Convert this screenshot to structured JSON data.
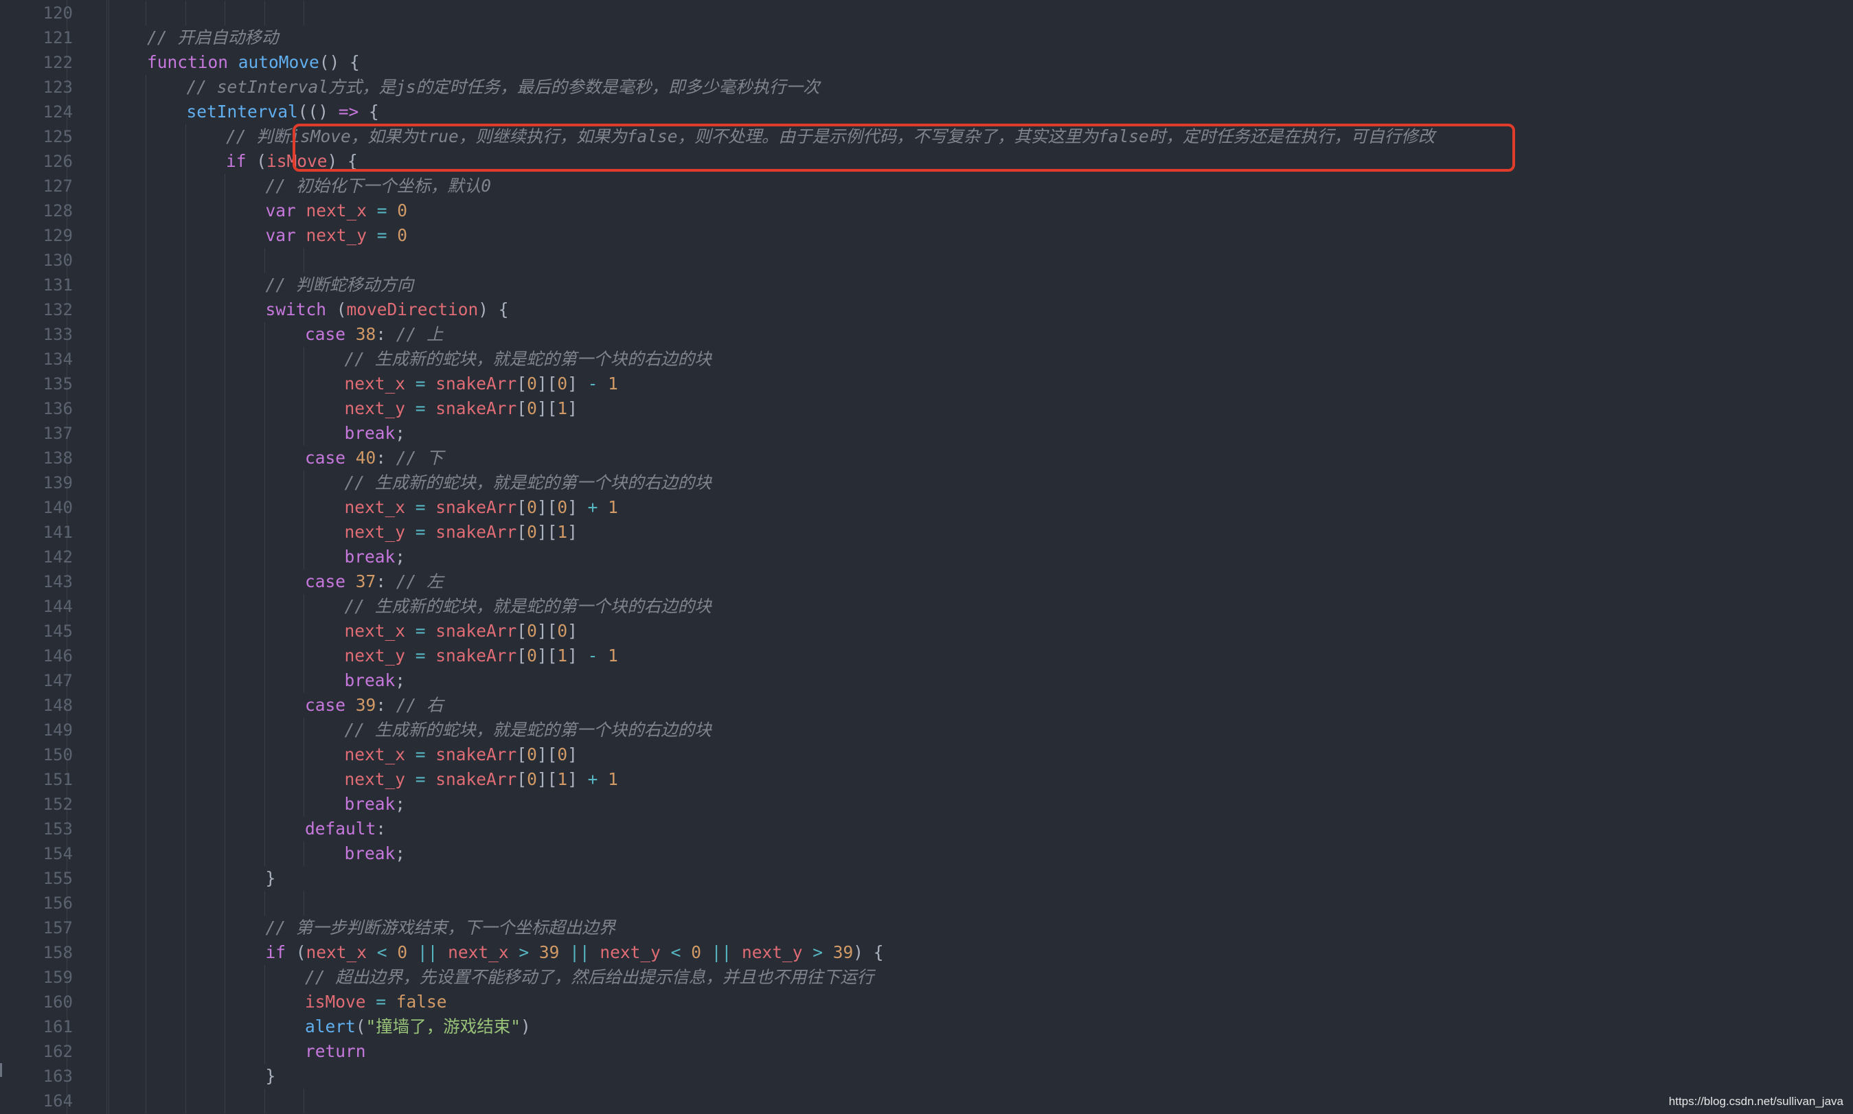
{
  "editor": {
    "lines": [
      {
        "n": "120",
        "indent": 0,
        "tokens": []
      },
      {
        "n": "121",
        "indent": 3,
        "tokens": [
          {
            "c": "cm",
            "t": "// 开启自动移动"
          }
        ]
      },
      {
        "n": "122",
        "indent": 3,
        "tokens": [
          {
            "c": "kw",
            "t": "function "
          },
          {
            "c": "fn",
            "t": "autoMove"
          },
          {
            "c": "pu",
            "t": "() {"
          }
        ]
      },
      {
        "n": "123",
        "indent": 4,
        "tokens": [
          {
            "c": "cm",
            "t": "// setInterval方式，是js的定时任务，最后的参数是毫秒，即多少毫秒执行一次"
          }
        ]
      },
      {
        "n": "124",
        "indent": 4,
        "tokens": [
          {
            "c": "fn",
            "t": "setInterval"
          },
          {
            "c": "pu",
            "t": "(() "
          },
          {
            "c": "kw",
            "t": "=>"
          },
          {
            "c": "pu",
            "t": " {"
          }
        ]
      },
      {
        "n": "125",
        "indent": 5,
        "tokens": [
          {
            "c": "cm",
            "t": "// 判断isMove，如果为true，则继续执行，如果为false，则不处理。由于是示例代码，不写复杂了，其实这里为false时，定时任务还是在执行，可自行修改"
          }
        ]
      },
      {
        "n": "126",
        "indent": 5,
        "tokens": [
          {
            "c": "kw",
            "t": "if"
          },
          {
            "c": "pu",
            "t": " ("
          },
          {
            "c": "var",
            "t": "isMove"
          },
          {
            "c": "pu",
            "t": ") {"
          }
        ]
      },
      {
        "n": "127",
        "indent": 6,
        "tokens": [
          {
            "c": "cm",
            "t": "// 初始化下一个坐标，默认0"
          }
        ]
      },
      {
        "n": "128",
        "indent": 6,
        "tokens": [
          {
            "c": "kw",
            "t": "var "
          },
          {
            "c": "var",
            "t": "next_x"
          },
          {
            "c": "op",
            "t": " = "
          },
          {
            "c": "num",
            "t": "0"
          }
        ]
      },
      {
        "n": "129",
        "indent": 6,
        "tokens": [
          {
            "c": "kw",
            "t": "var "
          },
          {
            "c": "var",
            "t": "next_y"
          },
          {
            "c": "op",
            "t": " = "
          },
          {
            "c": "num",
            "t": "0"
          }
        ]
      },
      {
        "n": "130",
        "indent": 0,
        "tokens": []
      },
      {
        "n": "131",
        "indent": 6,
        "tokens": [
          {
            "c": "cm",
            "t": "// 判断蛇移动方向"
          }
        ]
      },
      {
        "n": "132",
        "indent": 6,
        "tokens": [
          {
            "c": "kw",
            "t": "switch"
          },
          {
            "c": "pu",
            "t": " ("
          },
          {
            "c": "var",
            "t": "moveDirection"
          },
          {
            "c": "pu",
            "t": ") {"
          }
        ]
      },
      {
        "n": "133",
        "indent": 7,
        "tokens": [
          {
            "c": "kw",
            "t": "case "
          },
          {
            "c": "num",
            "t": "38"
          },
          {
            "c": "pu",
            "t": ": "
          },
          {
            "c": "cm",
            "t": "// 上"
          }
        ]
      },
      {
        "n": "134",
        "indent": 8,
        "tokens": [
          {
            "c": "cm",
            "t": "// 生成新的蛇块，就是蛇的第一个块的右边的块"
          }
        ]
      },
      {
        "n": "135",
        "indent": 8,
        "tokens": [
          {
            "c": "var",
            "t": "next_x"
          },
          {
            "c": "op",
            "t": " = "
          },
          {
            "c": "var",
            "t": "snakeArr"
          },
          {
            "c": "pu",
            "t": "["
          },
          {
            "c": "num",
            "t": "0"
          },
          {
            "c": "pu",
            "t": "]["
          },
          {
            "c": "num",
            "t": "0"
          },
          {
            "c": "pu",
            "t": "]"
          },
          {
            "c": "op",
            "t": " - "
          },
          {
            "c": "num",
            "t": "1"
          }
        ]
      },
      {
        "n": "136",
        "indent": 8,
        "tokens": [
          {
            "c": "var",
            "t": "next_y"
          },
          {
            "c": "op",
            "t": " = "
          },
          {
            "c": "var",
            "t": "snakeArr"
          },
          {
            "c": "pu",
            "t": "["
          },
          {
            "c": "num",
            "t": "0"
          },
          {
            "c": "pu",
            "t": "]["
          },
          {
            "c": "num",
            "t": "1"
          },
          {
            "c": "pu",
            "t": "]"
          }
        ]
      },
      {
        "n": "137",
        "indent": 8,
        "tokens": [
          {
            "c": "kw",
            "t": "break"
          },
          {
            "c": "pu",
            "t": ";"
          }
        ]
      },
      {
        "n": "138",
        "indent": 7,
        "tokens": [
          {
            "c": "kw",
            "t": "case "
          },
          {
            "c": "num",
            "t": "40"
          },
          {
            "c": "pu",
            "t": ": "
          },
          {
            "c": "cm",
            "t": "// 下"
          }
        ]
      },
      {
        "n": "139",
        "indent": 8,
        "tokens": [
          {
            "c": "cm",
            "t": "// 生成新的蛇块，就是蛇的第一个块的右边的块"
          }
        ]
      },
      {
        "n": "140",
        "indent": 8,
        "tokens": [
          {
            "c": "var",
            "t": "next_x"
          },
          {
            "c": "op",
            "t": " = "
          },
          {
            "c": "var",
            "t": "snakeArr"
          },
          {
            "c": "pu",
            "t": "["
          },
          {
            "c": "num",
            "t": "0"
          },
          {
            "c": "pu",
            "t": "]["
          },
          {
            "c": "num",
            "t": "0"
          },
          {
            "c": "pu",
            "t": "]"
          },
          {
            "c": "op",
            "t": " + "
          },
          {
            "c": "num",
            "t": "1"
          }
        ]
      },
      {
        "n": "141",
        "indent": 8,
        "tokens": [
          {
            "c": "var",
            "t": "next_y"
          },
          {
            "c": "op",
            "t": " = "
          },
          {
            "c": "var",
            "t": "snakeArr"
          },
          {
            "c": "pu",
            "t": "["
          },
          {
            "c": "num",
            "t": "0"
          },
          {
            "c": "pu",
            "t": "]["
          },
          {
            "c": "num",
            "t": "1"
          },
          {
            "c": "pu",
            "t": "]"
          }
        ]
      },
      {
        "n": "142",
        "indent": 8,
        "tokens": [
          {
            "c": "kw",
            "t": "break"
          },
          {
            "c": "pu",
            "t": ";"
          }
        ]
      },
      {
        "n": "143",
        "indent": 7,
        "tokens": [
          {
            "c": "kw",
            "t": "case "
          },
          {
            "c": "num",
            "t": "37"
          },
          {
            "c": "pu",
            "t": ": "
          },
          {
            "c": "cm",
            "t": "// 左"
          }
        ]
      },
      {
        "n": "144",
        "indent": 8,
        "tokens": [
          {
            "c": "cm",
            "t": "// 生成新的蛇块，就是蛇的第一个块的右边的块"
          }
        ]
      },
      {
        "n": "145",
        "indent": 8,
        "tokens": [
          {
            "c": "var",
            "t": "next_x"
          },
          {
            "c": "op",
            "t": " = "
          },
          {
            "c": "var",
            "t": "snakeArr"
          },
          {
            "c": "pu",
            "t": "["
          },
          {
            "c": "num",
            "t": "0"
          },
          {
            "c": "pu",
            "t": "]["
          },
          {
            "c": "num",
            "t": "0"
          },
          {
            "c": "pu",
            "t": "]"
          }
        ]
      },
      {
        "n": "146",
        "indent": 8,
        "tokens": [
          {
            "c": "var",
            "t": "next_y"
          },
          {
            "c": "op",
            "t": " = "
          },
          {
            "c": "var",
            "t": "snakeArr"
          },
          {
            "c": "pu",
            "t": "["
          },
          {
            "c": "num",
            "t": "0"
          },
          {
            "c": "pu",
            "t": "]["
          },
          {
            "c": "num",
            "t": "1"
          },
          {
            "c": "pu",
            "t": "]"
          },
          {
            "c": "op",
            "t": " - "
          },
          {
            "c": "num",
            "t": "1"
          }
        ]
      },
      {
        "n": "147",
        "indent": 8,
        "tokens": [
          {
            "c": "kw",
            "t": "break"
          },
          {
            "c": "pu",
            "t": ";"
          }
        ]
      },
      {
        "n": "148",
        "indent": 7,
        "tokens": [
          {
            "c": "kw",
            "t": "case "
          },
          {
            "c": "num",
            "t": "39"
          },
          {
            "c": "pu",
            "t": ": "
          },
          {
            "c": "cm",
            "t": "// 右"
          }
        ]
      },
      {
        "n": "149",
        "indent": 8,
        "tokens": [
          {
            "c": "cm",
            "t": "// 生成新的蛇块，就是蛇的第一个块的右边的块"
          }
        ]
      },
      {
        "n": "150",
        "indent": 8,
        "tokens": [
          {
            "c": "var",
            "t": "next_x"
          },
          {
            "c": "op",
            "t": " = "
          },
          {
            "c": "var",
            "t": "snakeArr"
          },
          {
            "c": "pu",
            "t": "["
          },
          {
            "c": "num",
            "t": "0"
          },
          {
            "c": "pu",
            "t": "]["
          },
          {
            "c": "num",
            "t": "0"
          },
          {
            "c": "pu",
            "t": "]"
          }
        ]
      },
      {
        "n": "151",
        "indent": 8,
        "tokens": [
          {
            "c": "var",
            "t": "next_y"
          },
          {
            "c": "op",
            "t": " = "
          },
          {
            "c": "var",
            "t": "snakeArr"
          },
          {
            "c": "pu",
            "t": "["
          },
          {
            "c": "num",
            "t": "0"
          },
          {
            "c": "pu",
            "t": "]["
          },
          {
            "c": "num",
            "t": "1"
          },
          {
            "c": "pu",
            "t": "]"
          },
          {
            "c": "op",
            "t": " + "
          },
          {
            "c": "num",
            "t": "1"
          }
        ]
      },
      {
        "n": "152",
        "indent": 8,
        "tokens": [
          {
            "c": "kw",
            "t": "break"
          },
          {
            "c": "pu",
            "t": ";"
          }
        ]
      },
      {
        "n": "153",
        "indent": 7,
        "tokens": [
          {
            "c": "kw",
            "t": "default"
          },
          {
            "c": "pu",
            "t": ":"
          }
        ]
      },
      {
        "n": "154",
        "indent": 8,
        "tokens": [
          {
            "c": "kw",
            "t": "break"
          },
          {
            "c": "pu",
            "t": ";"
          }
        ]
      },
      {
        "n": "155",
        "indent": 6,
        "tokens": [
          {
            "c": "pu",
            "t": "}"
          }
        ]
      },
      {
        "n": "156",
        "indent": 0,
        "tokens": []
      },
      {
        "n": "157",
        "indent": 6,
        "tokens": [
          {
            "c": "cm",
            "t": "// 第一步判断游戏结束，下一个坐标超出边界"
          }
        ]
      },
      {
        "n": "158",
        "indent": 6,
        "tokens": [
          {
            "c": "kw",
            "t": "if"
          },
          {
            "c": "pu",
            "t": " ("
          },
          {
            "c": "var",
            "t": "next_x"
          },
          {
            "c": "op",
            "t": " < "
          },
          {
            "c": "num",
            "t": "0"
          },
          {
            "c": "op",
            "t": " || "
          },
          {
            "c": "var",
            "t": "next_x"
          },
          {
            "c": "op",
            "t": " > "
          },
          {
            "c": "num",
            "t": "39"
          },
          {
            "c": "op",
            "t": " || "
          },
          {
            "c": "var",
            "t": "next_y"
          },
          {
            "c": "op",
            "t": " < "
          },
          {
            "c": "num",
            "t": "0"
          },
          {
            "c": "op",
            "t": " || "
          },
          {
            "c": "var",
            "t": "next_y"
          },
          {
            "c": "op",
            "t": " > "
          },
          {
            "c": "num",
            "t": "39"
          },
          {
            "c": "pu",
            "t": ") {"
          }
        ]
      },
      {
        "n": "159",
        "indent": 7,
        "tokens": [
          {
            "c": "cm",
            "t": "// 超出边界，先设置不能移动了，然后给出提示信息，并且也不用往下运行"
          }
        ]
      },
      {
        "n": "160",
        "indent": 7,
        "tokens": [
          {
            "c": "var",
            "t": "isMove"
          },
          {
            "c": "op",
            "t": " = "
          },
          {
            "c": "num",
            "t": "false"
          }
        ]
      },
      {
        "n": "161",
        "indent": 7,
        "tokens": [
          {
            "c": "fn",
            "t": "alert"
          },
          {
            "c": "pu",
            "t": "("
          },
          {
            "c": "str",
            "t": "\"撞墙了，游戏结束\""
          },
          {
            "c": "pu",
            "t": ")"
          }
        ]
      },
      {
        "n": "162",
        "indent": 7,
        "tokens": [
          {
            "c": "kw",
            "t": "return"
          }
        ]
      },
      {
        "n": "163",
        "indent": 6,
        "tokens": [
          {
            "c": "pu",
            "t": "}"
          }
        ]
      },
      {
        "n": "164",
        "indent": 0,
        "tokens": []
      }
    ]
  },
  "highlight": {
    "color": "#e03c2c",
    "from_line": "125",
    "to_line": "126"
  },
  "watermark": "https://blog.csdn.net/sullivan_java",
  "colors": {
    "background": "#282c34",
    "line_number": "#5c6370",
    "comment": "#7f848e",
    "keyword": "#c678dd",
    "function": "#61afef",
    "variable": "#e06c75",
    "number": "#d19a66",
    "string": "#98c379",
    "operator": "#56b6c2"
  }
}
